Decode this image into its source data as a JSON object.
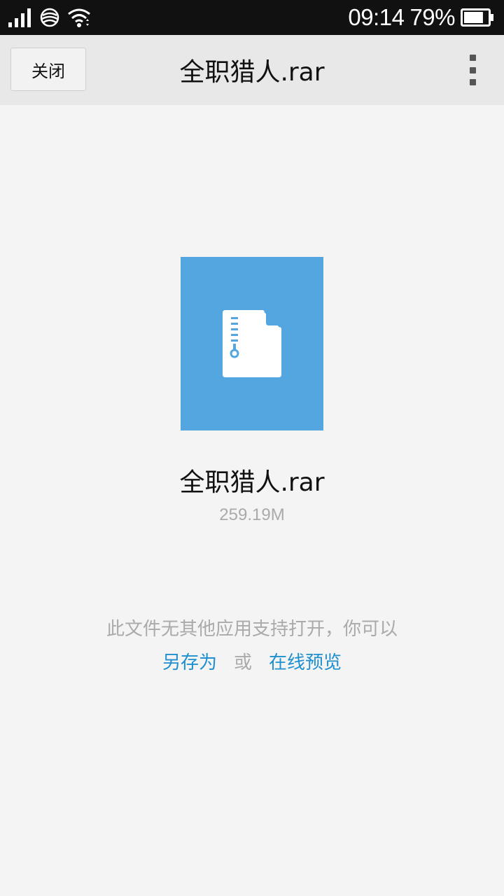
{
  "status_bar": {
    "time": "09:14",
    "battery_percent": "79%",
    "battery_level": 0.79,
    "icons": [
      "signal-icon",
      "carrier-logo-icon",
      "wifi-icon",
      "battery-icon"
    ]
  },
  "titlebar": {
    "close_label": "关闭",
    "title": "全职猎人.rar",
    "more_icon": "more-vertical-icon"
  },
  "file": {
    "icon": "zip-file-icon",
    "name": "全职猎人.rar",
    "size": "259.19M",
    "thumb_color": "#53a6e0"
  },
  "notice": {
    "message": "此文件无其他应用支持打开，你可以",
    "save_as_label": "另存为",
    "or_label": "或",
    "preview_label": "在线预览",
    "link_color": "#1f8fd0"
  }
}
